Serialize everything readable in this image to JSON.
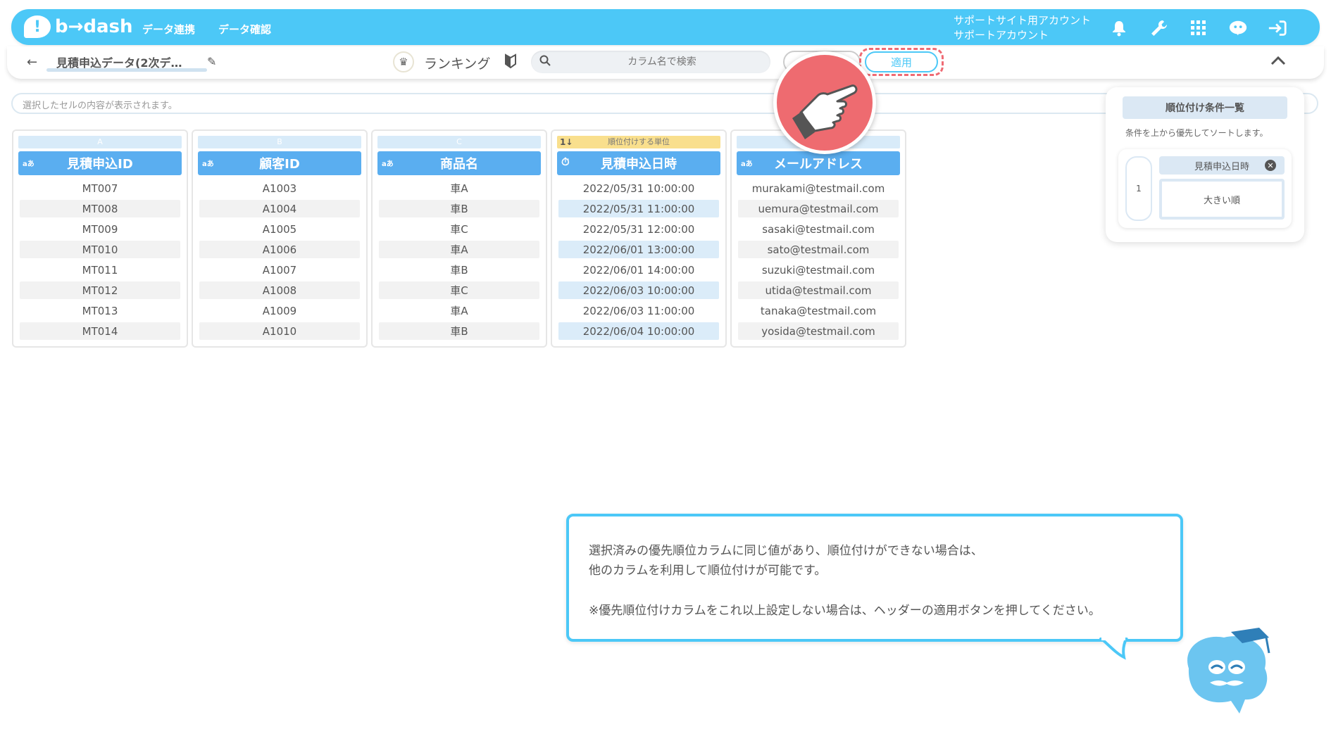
{
  "header": {
    "logo_text": "b→dash",
    "nav": [
      "データ連携",
      "データ確認"
    ],
    "account_line1": "サポートサイト用アカウント",
    "account_line2": "サポートアカウント"
  },
  "toolbar": {
    "dataset_name": "見積申込データ(2次デ…",
    "ranking_label": "ランキング",
    "search_placeholder": "カラム名で検索",
    "apply_label": "適用"
  },
  "cell_bar": {
    "placeholder": "選択したセルの内容が表示されます。"
  },
  "columns": [
    {
      "letter": "A",
      "type": "aあ",
      "name": "見積申込ID",
      "values": [
        "MT007",
        "MT008",
        "MT009",
        "MT010",
        "MT011",
        "MT012",
        "MT013",
        "MT014"
      ]
    },
    {
      "letter": "B",
      "type": "aあ",
      "name": "顧客ID",
      "values": [
        "A1003",
        "A1004",
        "A1005",
        "A1006",
        "A1007",
        "A1008",
        "A1009",
        "A1010"
      ]
    },
    {
      "letter": "C",
      "type": "aあ",
      "name": "商品名",
      "values": [
        "車A",
        "車B",
        "車C",
        "車A",
        "車B",
        "車C",
        "車A",
        "車B"
      ]
    },
    {
      "letter": "順位付けする単位",
      "type": "⏱",
      "name": "見積申込日時",
      "sort_icon": "1↓",
      "values": [
        "2022/05/31 10:00:00",
        "2022/05/31 11:00:00",
        "2022/05/31 12:00:00",
        "2022/06/01 13:00:00",
        "2022/06/01 14:00:00",
        "2022/06/03 10:00:00",
        "2022/06/03 11:00:00",
        "2022/06/04 10:00:00"
      ]
    },
    {
      "letter": "",
      "type": "aあ",
      "name": "メールアドレス",
      "values": [
        "murakami@testmail.com",
        "uemura@testmail.com",
        "sasaki@testmail.com",
        "sato@testmail.com",
        "suzuki@testmail.com",
        "utida@testmail.com",
        "tanaka@testmail.com",
        "yosida@testmail.com"
      ]
    }
  ],
  "sort_panel": {
    "title": "順位付け条件一覧",
    "description": "条件を上から優先してソートします。",
    "conditions": [
      {
        "priority": "1",
        "column": "見積申込日時",
        "order": "大きい順"
      }
    ]
  },
  "tooltip": {
    "line1": "選択済みの優先順位カラムに同じ値があり、順位付けができない場合は、",
    "line2": "他のカラムを利用して順位付けが可能です。",
    "line3": "※優先順位付けカラムをこれ以上設定しない場合は、ヘッダーの適用ボタンを押してください。"
  },
  "colors": {
    "brand": "#4cc8f7",
    "header_blue": "#5aaef0",
    "highlight": "#ef6b74",
    "rank_label": "#f9df8d"
  }
}
